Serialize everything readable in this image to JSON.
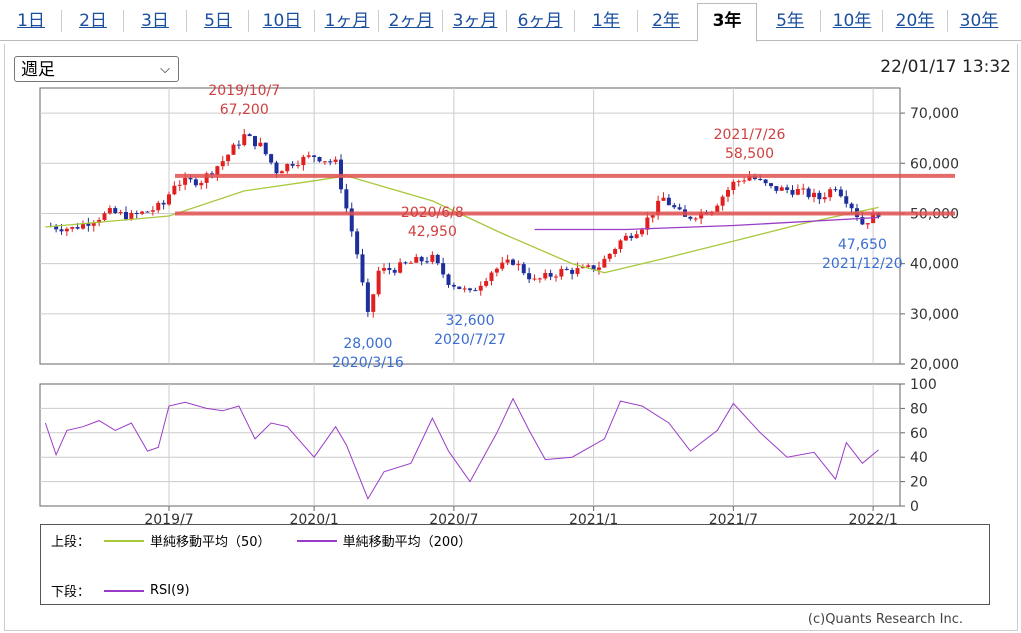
{
  "tabs": [
    {
      "label": "1日",
      "active": false
    },
    {
      "label": "2日",
      "active": false
    },
    {
      "label": "3日",
      "active": false
    },
    {
      "label": "5日",
      "active": false
    },
    {
      "label": "10日",
      "active": false
    },
    {
      "label": "1ヶ月",
      "active": false
    },
    {
      "label": "2ヶ月",
      "active": false
    },
    {
      "label": "3ヶ月",
      "active": false
    },
    {
      "label": "6ヶ月",
      "active": false
    },
    {
      "label": "1年",
      "active": false
    },
    {
      "label": "2年",
      "active": false
    },
    {
      "label": "3年",
      "active": true
    },
    {
      "label": "5年",
      "active": false
    },
    {
      "label": "10年",
      "active": false
    },
    {
      "label": "20年",
      "active": false
    },
    {
      "label": "30年",
      "active": false
    }
  ],
  "period_select": {
    "value": "週足"
  },
  "timestamp": "22/01/17 13:32",
  "chart_data": [
    {
      "type": "candlestick",
      "panel": "price",
      "ylim": [
        20000,
        75000
      ],
      "yticks": [
        20000,
        30000,
        40000,
        50000,
        60000,
        70000
      ],
      "ytick_labels": [
        "20,000",
        "30,000",
        "40,000",
        "50,000",
        "60,000",
        "70,000"
      ],
      "xlim": [
        "2019-01-14",
        "2022-02-07"
      ],
      "xticks": [
        "2019-07-01",
        "2020-01-06",
        "2020-07-06",
        "2021-01-04",
        "2021-07-05",
        "2022-01-03"
      ],
      "xtick_labels": [
        "2019/7",
        "2020/1",
        "2020/7",
        "2021/1",
        "2021/7",
        "2022/1"
      ],
      "grid": true,
      "colors": {
        "up": "#e02020",
        "down": "#1c2f9a",
        "sma50": "#a8c83c",
        "sma200": "#9a3cc8",
        "hline": "#e05050"
      },
      "close_path": [
        [
          "2019-01-21",
          47500
        ],
        [
          "2019-02-25",
          47000
        ],
        [
          "2019-03-25",
          48800
        ],
        [
          "2019-04-15",
          50200
        ],
        [
          "2019-05-13",
          49400
        ],
        [
          "2019-06-10",
          50800
        ],
        [
          "2019-06-24",
          51800
        ],
        [
          "2019-07-08",
          56000
        ],
        [
          "2019-08-12",
          56600
        ],
        [
          "2019-09-09",
          60500
        ],
        [
          "2019-10-07",
          65500
        ],
        [
          "2019-10-28",
          63500
        ],
        [
          "2019-11-18",
          58500
        ],
        [
          "2019-12-09",
          60200
        ],
        [
          "2020-01-06",
          61500
        ],
        [
          "2020-02-03",
          60000
        ],
        [
          "2020-02-17",
          51000
        ],
        [
          "2020-03-02",
          42000
        ],
        [
          "2020-03-16",
          29500
        ],
        [
          "2020-03-30",
          38500
        ],
        [
          "2020-04-20",
          39000
        ],
        [
          "2020-05-18",
          40500
        ],
        [
          "2020-06-08",
          41000
        ],
        [
          "2020-06-29",
          36500
        ],
        [
          "2020-07-27",
          34000
        ],
        [
          "2020-08-24",
          38500
        ],
        [
          "2020-09-21",
          40500
        ],
        [
          "2020-10-19",
          36500
        ],
        [
          "2020-11-23",
          38500
        ],
        [
          "2020-12-21",
          38700
        ],
        [
          "2021-01-11",
          39500
        ],
        [
          "2021-02-08",
          44500
        ],
        [
          "2021-03-08",
          47500
        ],
        [
          "2021-04-05",
          53000
        ],
        [
          "2021-05-03",
          49000
        ],
        [
          "2021-06-07",
          51000
        ],
        [
          "2021-07-05",
          56000
        ],
        [
          "2021-07-26",
          57500
        ],
        [
          "2021-08-23",
          55000
        ],
        [
          "2021-09-27",
          54500
        ],
        [
          "2021-10-25",
          53000
        ],
        [
          "2021-11-15",
          55500
        ],
        [
          "2021-12-06",
          51500
        ],
        [
          "2021-12-20",
          48000
        ],
        [
          "2022-01-10",
          50200
        ]
      ],
      "sma50": [
        [
          "2019-01-21",
          47300
        ],
        [
          "2019-07-01",
          49500
        ],
        [
          "2019-10-07",
          54500
        ],
        [
          "2020-01-06",
          56500
        ],
        [
          "2020-02-17",
          57500
        ],
        [
          "2020-06-08",
          52500
        ],
        [
          "2020-09-07",
          46000
        ],
        [
          "2020-12-07",
          40000
        ],
        [
          "2021-01-18",
          38200
        ],
        [
          "2021-04-05",
          41000
        ],
        [
          "2021-07-05",
          44500
        ],
        [
          "2021-10-04",
          48000
        ],
        [
          "2022-01-10",
          51200
        ]
      ],
      "sma200": [
        [
          "2020-10-19",
          46800
        ],
        [
          "2021-02-15",
          46800
        ],
        [
          "2021-07-05",
          47600
        ],
        [
          "2022-01-10",
          49200
        ]
      ],
      "hlines": [
        57500,
        50000
      ],
      "annotations": [
        {
          "text": "2019/10/7",
          "x": "2019-10-07",
          "y": 67200,
          "color": "#d04040",
          "pos": "above"
        },
        {
          "text": "67,200",
          "x": "2019-10-07",
          "y": 67200,
          "color": "#d04040",
          "pos": "above2"
        },
        {
          "text": "2020/3/16",
          "x": "2020-03-16",
          "y": 28000,
          "color": "#3a6ed0",
          "pos": "below2"
        },
        {
          "text": "28,000",
          "x": "2020-03-16",
          "y": 28000,
          "color": "#3a6ed0",
          "pos": "below"
        },
        {
          "text": "2020/6/8",
          "x": "2020-06-08",
          "y": 42950,
          "color": "#d04040",
          "pos": "above"
        },
        {
          "text": "42,950",
          "x": "2020-06-08",
          "y": 42950,
          "color": "#d04040",
          "pos": "above2"
        },
        {
          "text": "2020/7/27",
          "x": "2020-07-27",
          "y": 32600,
          "color": "#3a6ed0",
          "pos": "below2"
        },
        {
          "text": "32,600",
          "x": "2020-07-27",
          "y": 32600,
          "color": "#3a6ed0",
          "pos": "below"
        },
        {
          "text": "2021/7/26",
          "x": "2021-07-26",
          "y": 58500,
          "color": "#d04040",
          "pos": "above"
        },
        {
          "text": "58,500",
          "x": "2021-07-26",
          "y": 58500,
          "color": "#d04040",
          "pos": "above2"
        },
        {
          "text": "2021/12/20",
          "x": "2021-12-20",
          "y": 47650,
          "color": "#3a6ed0",
          "pos": "below2"
        },
        {
          "text": "47,650",
          "x": "2021-12-20",
          "y": 47650,
          "color": "#3a6ed0",
          "pos": "below"
        }
      ]
    },
    {
      "type": "line",
      "panel": "rsi",
      "ylim": [
        0,
        100
      ],
      "yticks": [
        0,
        20,
        40,
        60,
        80,
        100
      ],
      "ytick_labels": [
        "0",
        "20",
        "40",
        "60",
        "80",
        "100"
      ],
      "grid": true,
      "series": [
        {
          "color": "#9a3cc8",
          "points": [
            [
              "2019-01-21",
              68
            ],
            [
              "2019-02-04",
              42
            ],
            [
              "2019-02-18",
              62
            ],
            [
              "2019-03-11",
              65
            ],
            [
              "2019-04-01",
              70
            ],
            [
              "2019-04-22",
              62
            ],
            [
              "2019-05-13",
              68
            ],
            [
              "2019-06-03",
              45
            ],
            [
              "2019-06-17",
              48
            ],
            [
              "2019-07-01",
              82
            ],
            [
              "2019-07-22",
              85
            ],
            [
              "2019-08-19",
              80
            ],
            [
              "2019-09-09",
              78
            ],
            [
              "2019-09-30",
              82
            ],
            [
              "2019-10-21",
              55
            ],
            [
              "2019-11-11",
              68
            ],
            [
              "2019-12-02",
              65
            ],
            [
              "2020-01-06",
              40
            ],
            [
              "2020-02-03",
              65
            ],
            [
              "2020-02-17",
              50
            ],
            [
              "2020-03-16",
              6
            ],
            [
              "2020-04-06",
              28
            ],
            [
              "2020-05-11",
              35
            ],
            [
              "2020-06-08",
              72
            ],
            [
              "2020-06-29",
              45
            ],
            [
              "2020-07-27",
              20
            ],
            [
              "2020-08-31",
              60
            ],
            [
              "2020-09-21",
              88
            ],
            [
              "2020-10-12",
              62
            ],
            [
              "2020-11-02",
              38
            ],
            [
              "2020-12-07",
              40
            ],
            [
              "2021-01-18",
              55
            ],
            [
              "2021-02-08",
              86
            ],
            [
              "2021-03-08",
              82
            ],
            [
              "2021-04-12",
              68
            ],
            [
              "2021-05-10",
              45
            ],
            [
              "2021-06-14",
              62
            ],
            [
              "2021-07-05",
              84
            ],
            [
              "2021-08-09",
              60
            ],
            [
              "2021-09-13",
              40
            ],
            [
              "2021-10-18",
              44
            ],
            [
              "2021-11-15",
              22
            ],
            [
              "2021-11-29",
              52
            ],
            [
              "2021-12-20",
              35
            ],
            [
              "2022-01-10",
              46
            ]
          ]
        }
      ]
    }
  ],
  "legend": {
    "upper_label": "上段：",
    "lower_label": "下段：",
    "items": [
      {
        "label": "単純移動平均（50）",
        "color": "#a8c83c"
      },
      {
        "label": "単純移動平均（200）",
        "color": "#9a3cc8"
      },
      {
        "label": "RSI(9)",
        "color": "#9a3cc8"
      }
    ]
  },
  "credit": "(c)Quants Research Inc."
}
